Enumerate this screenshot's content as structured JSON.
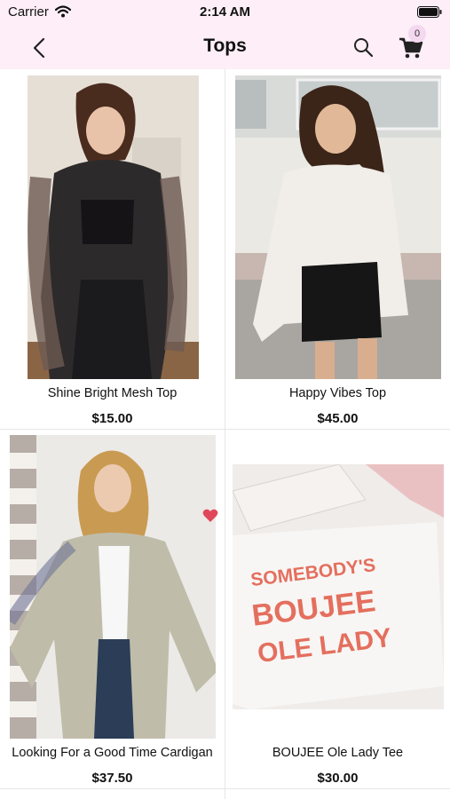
{
  "status_bar": {
    "carrier": "Carrier",
    "time": "2:14 AM"
  },
  "nav": {
    "title": "Tops",
    "cart_count": "0"
  },
  "products": [
    {
      "name": "Shine Bright Mesh Top",
      "price": "$15.00",
      "favorited": false
    },
    {
      "name": "Happy Vibes Top",
      "price": "$45.00",
      "favorited": false
    },
    {
      "name": "Looking For a Good Time Cardigan",
      "price": "$37.50",
      "favorited": true
    },
    {
      "name": "BOUJEE Ole Lady Tee",
      "price": "$30.00",
      "favorited": false
    }
  ],
  "tee_print": {
    "line1": "SOMEBODY'S",
    "line2": "BOUJEE",
    "line3": "OLE LADY"
  },
  "colors": {
    "header_bg": "#fdeef7",
    "badge_bg": "#f3d8ef",
    "heart": "#e0475b",
    "tee_text": "#e46f5e"
  }
}
